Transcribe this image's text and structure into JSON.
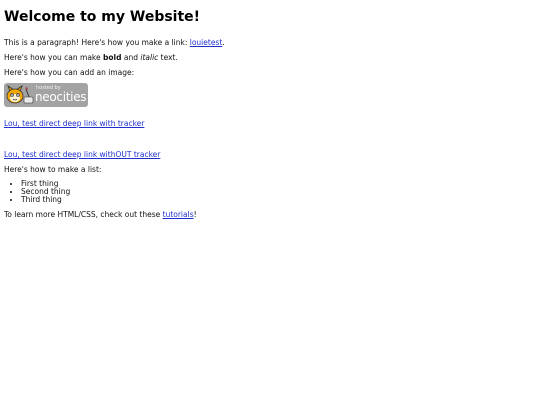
{
  "header": {
    "title": "Welcome to my Website!"
  },
  "content": {
    "p1_text": "This is a paragraph! Here's how you make a link: ",
    "p1_link": "louietest",
    "p1_end": ".",
    "p2_start": "Here's how you can make ",
    "p2_bold": "bold",
    "p2_mid": " and ",
    "p2_italic": "italic",
    "p2_end": " text.",
    "p3_text": "Here's how you can add an image:",
    "badge": {
      "hosted_text": "hosted by",
      "brand_text": "neocities"
    },
    "link_tracker": "Lou, test direct deep link with tracker",
    "link_no_tracker": "Lou, test direct deep link withOUT tracker",
    "list_intro": "Here's how to make a list:",
    "list_items": [
      "First thing",
      "Second thing",
      "Third thing"
    ],
    "footer_start": "To learn more HTML/CSS, check out these ",
    "footer_link": "tutorials",
    "footer_end": "!"
  }
}
